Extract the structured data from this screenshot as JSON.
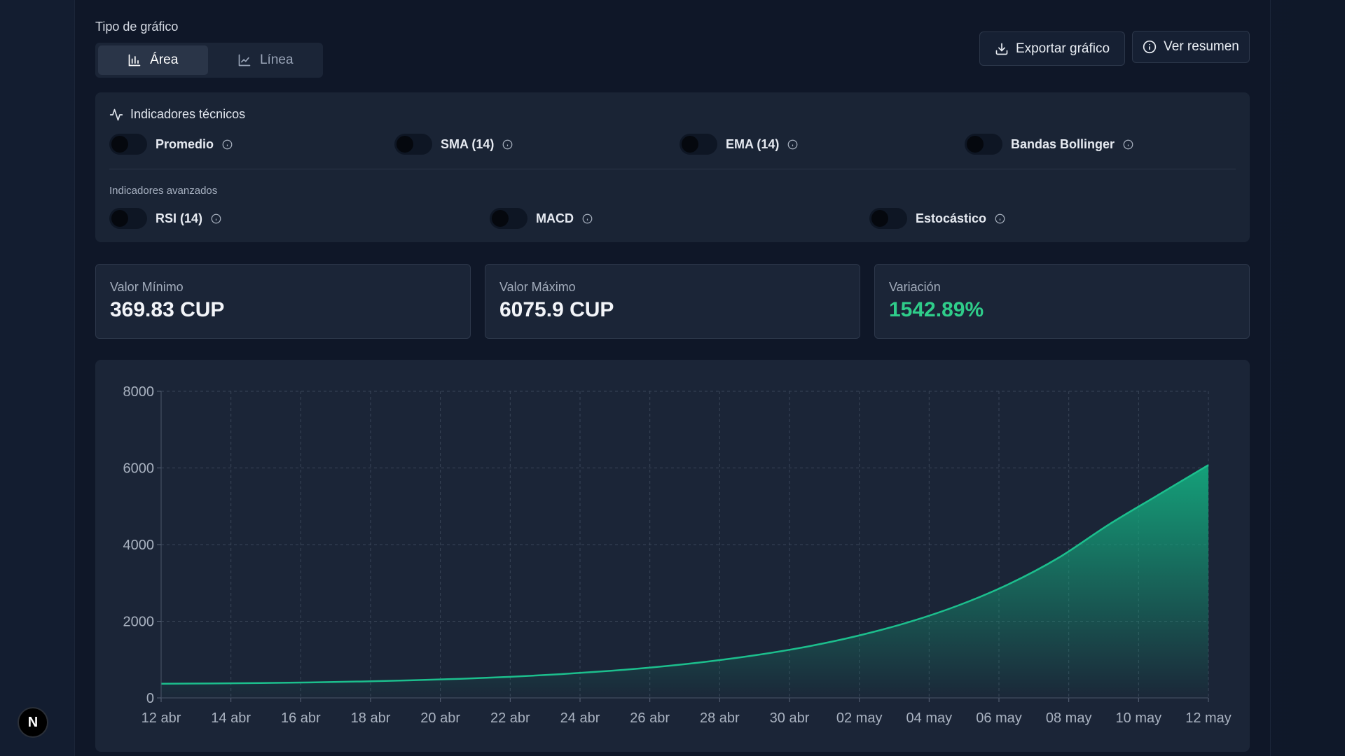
{
  "header": {
    "chart_type_label": "Tipo de gráfico",
    "types": [
      {
        "label": "Área",
        "active": true,
        "icon": "bar-chart-icon"
      },
      {
        "label": "Línea",
        "active": false,
        "icon": "line-chart-icon"
      }
    ],
    "export_label": "Exportar gráfico",
    "summary_label": "Ver resumen"
  },
  "indicators": {
    "title": "Indicadores técnicos",
    "basic": [
      {
        "label": "Promedio",
        "on": false
      },
      {
        "label": "SMA (14)",
        "on": false
      },
      {
        "label": "EMA (14)",
        "on": false
      },
      {
        "label": "Bandas Bollinger",
        "on": false
      }
    ],
    "advanced_label": "Indicadores avanzados",
    "advanced": [
      {
        "label": "RSI (14)",
        "on": false
      },
      {
        "label": "MACD",
        "on": false
      },
      {
        "label": "Estocástico",
        "on": false
      }
    ]
  },
  "stats": [
    {
      "label": "Valor Mínimo",
      "value": "369.83 CUP"
    },
    {
      "label": "Valor Máximo",
      "value": "6075.9 CUP"
    },
    {
      "label": "Variación",
      "value": "1542.89%"
    }
  ],
  "colors": {
    "accent": "#10a37f",
    "positive": "#2fcd8a",
    "background": "#0f1728"
  },
  "badge": {
    "label": "N"
  },
  "chart_data": {
    "type": "area",
    "title": "",
    "xlabel": "",
    "ylabel": "",
    "ylim": [
      0,
      8000
    ],
    "y_ticks": [
      "0",
      "2000",
      "4000",
      "6000",
      "8000"
    ],
    "x_ticks": [
      "12 abr",
      "14 abr",
      "16 abr",
      "18 abr",
      "20 abr",
      "22 abr",
      "24 abr",
      "26 abr",
      "28 abr",
      "30 abr",
      "02 may",
      "04 may",
      "06 may",
      "08 may",
      "10 may",
      "12 may"
    ],
    "grid": true,
    "series": [
      {
        "values": [
          369.83,
          377,
          388,
          405,
          428,
          458,
          498,
          550,
          618,
          705,
          815,
          955,
          1130,
          1350,
          1630,
          1980,
          2420,
          2970,
          3660,
          4520,
          5300,
          6075.9
        ]
      }
    ]
  }
}
